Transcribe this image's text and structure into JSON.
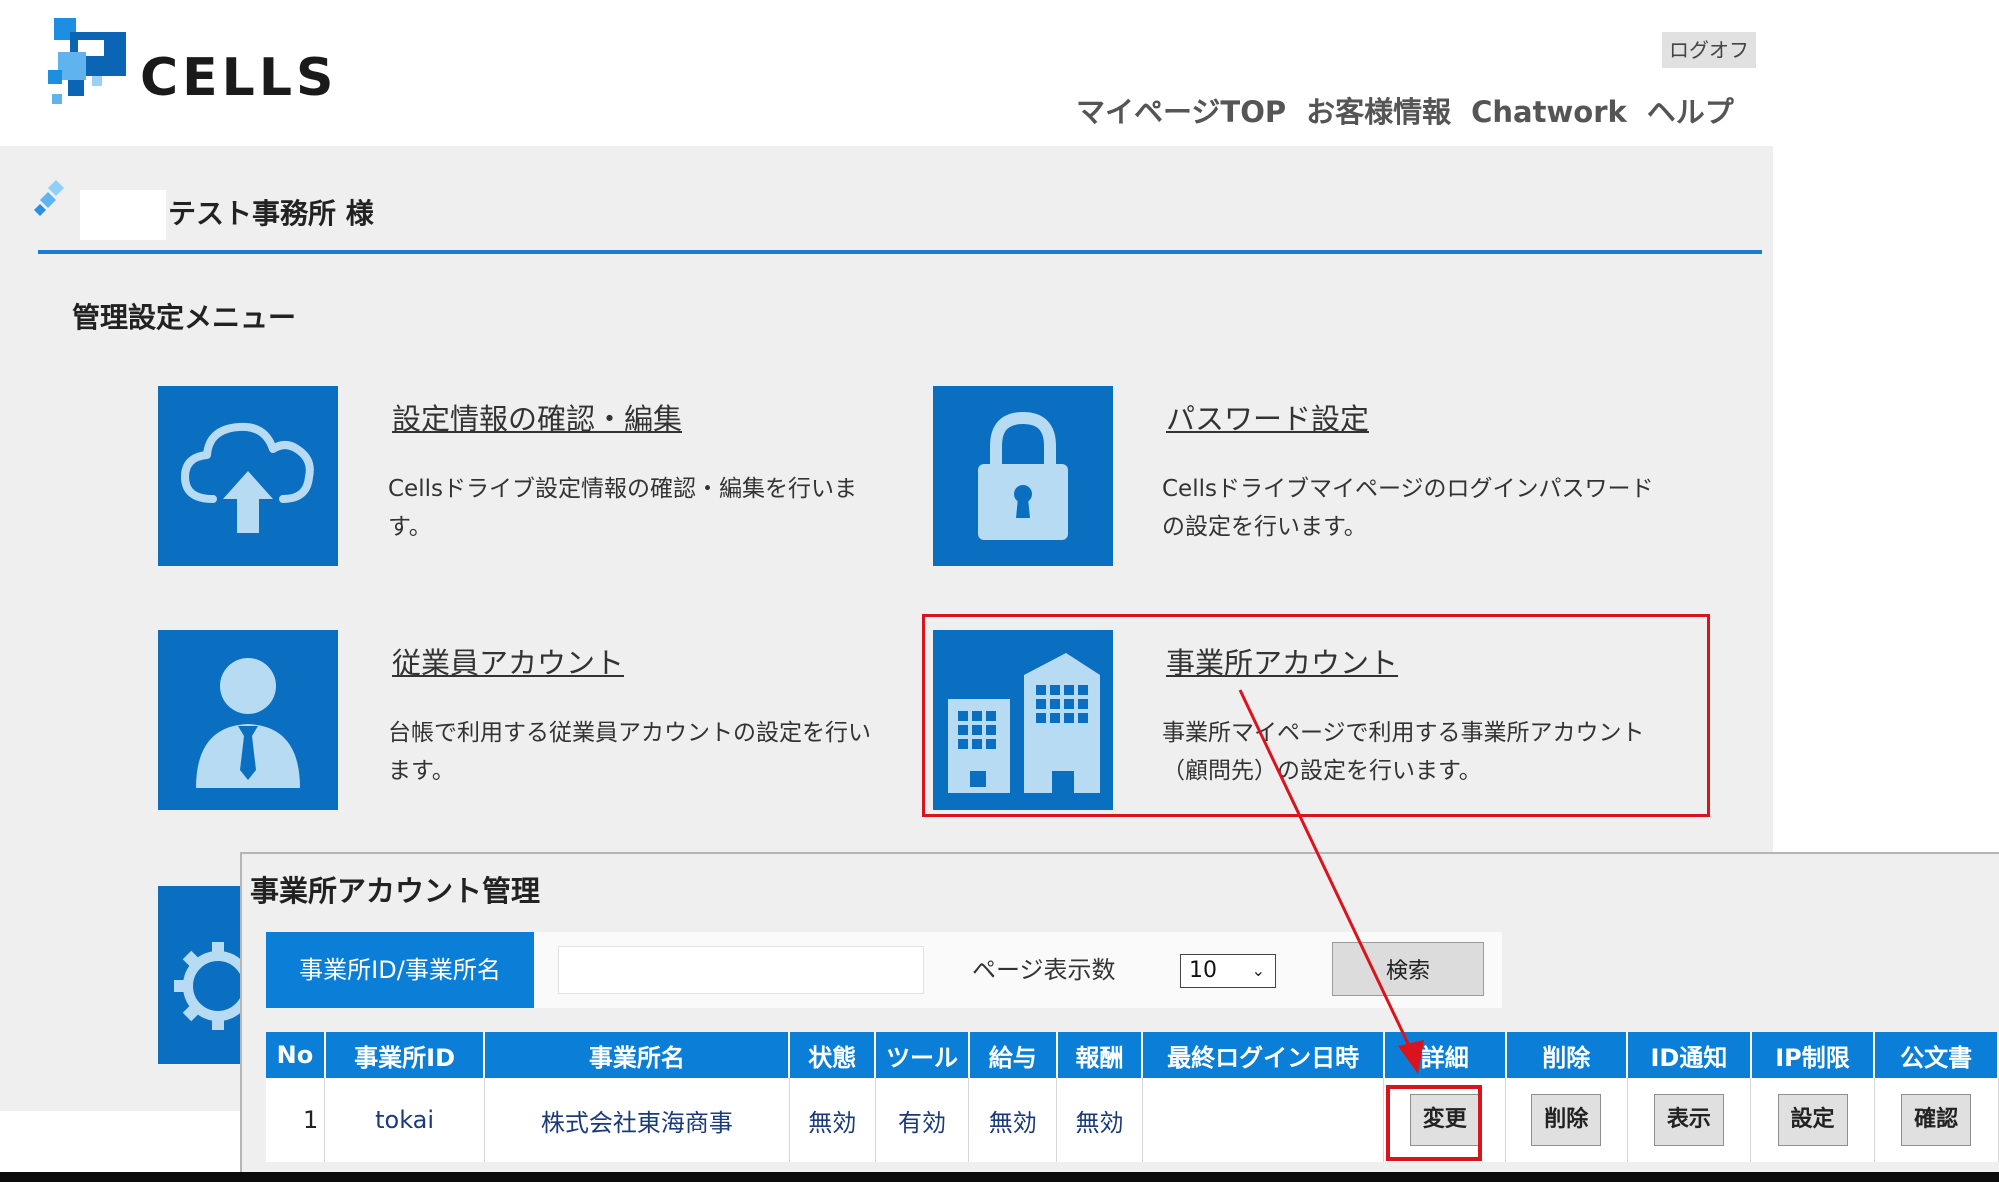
{
  "header": {
    "logo_text": "CELLS",
    "logoff_label": "ログオフ",
    "nav": [
      "マイページTOP",
      "お客様情報",
      "Chatwork",
      "ヘルプ"
    ]
  },
  "user": {
    "office_name": "テスト事務所 様"
  },
  "menu": {
    "heading": "管理設定メニュー",
    "items": [
      {
        "title": "設定情報の確認・編集",
        "desc": "Cellsドライブ設定情報の確認・編集を行います。",
        "icon": "cloud-upload-icon"
      },
      {
        "title": "パスワード設定",
        "desc": "Cellsドライブマイページのログインパスワードの設定を行います。",
        "icon": "lock-icon"
      },
      {
        "title": "従業員アカウント",
        "desc": "台帳で利用する従業員アカウントの設定を行います。",
        "icon": "person-icon"
      },
      {
        "title": "事業所アカウント",
        "desc": "事業所マイページで利用する事業所アカウント（顧問先）の設定を行います。",
        "icon": "building-icon"
      }
    ],
    "partial_icon": "gear-icon"
  },
  "office_accounts": {
    "title": "事業所アカウント管理",
    "search_label": "事業所ID/事業所名",
    "search_value": "",
    "page_count_label": "ページ表示数",
    "page_count_value": "10",
    "search_button": "検索",
    "columns": [
      "No",
      "事業所ID",
      "事業所名",
      "状態",
      "ツール",
      "給与",
      "報酬",
      "最終ログイン日時",
      "詳細",
      "削除",
      "ID通知",
      "IP制限",
      "公文書"
    ],
    "rows": [
      {
        "no": "1",
        "office_id": "tokai",
        "office_name": "株式会社東海商事",
        "status": "無効",
        "tool": "有効",
        "salary": "無効",
        "fee": "無効",
        "last_login": "",
        "detail_btn": "変更",
        "delete_btn": "削除",
        "id_notice_btn": "表示",
        "ip_btn": "設定",
        "doc_btn": "確認"
      }
    ]
  },
  "colors": {
    "brand_blue": "#0b6fc1",
    "header_blue": "#0b7fd8",
    "highlight_red": "#d9141c",
    "panel_gray": "#efefef"
  }
}
